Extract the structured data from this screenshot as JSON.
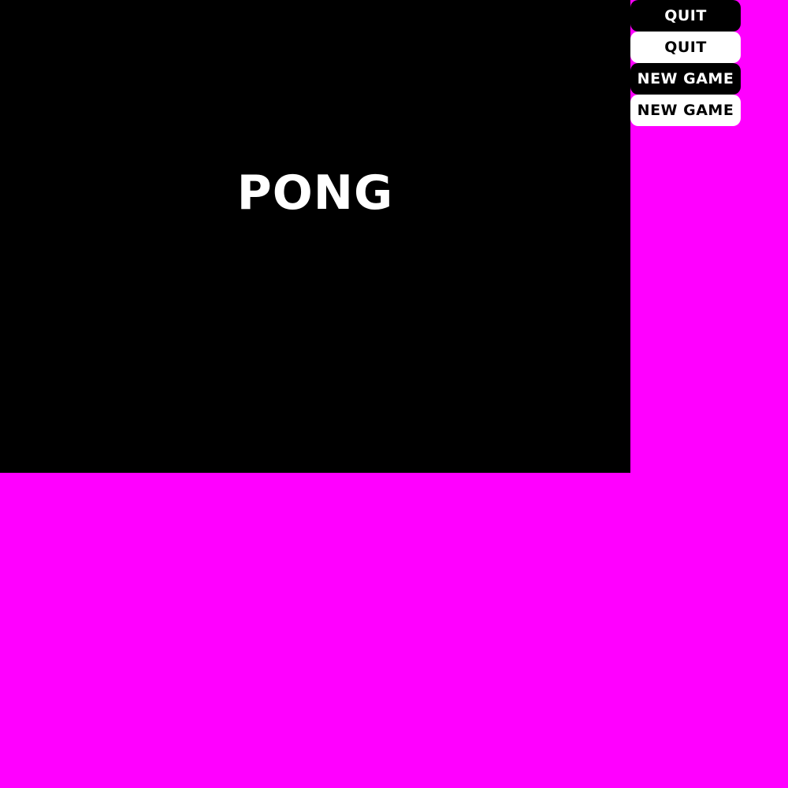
{
  "game": {
    "title": "PONG"
  },
  "buttons": [
    {
      "label": "QUIT",
      "style": "dark"
    },
    {
      "label": "QUIT",
      "style": "light"
    },
    {
      "label": "NEW GAME",
      "style": "dark"
    },
    {
      "label": "NEW GAME",
      "style": "light"
    }
  ],
  "colors": {
    "background": "#FF00FF",
    "stage": "#000000",
    "text_light": "#FFFFFF",
    "text_dark": "#000000"
  }
}
